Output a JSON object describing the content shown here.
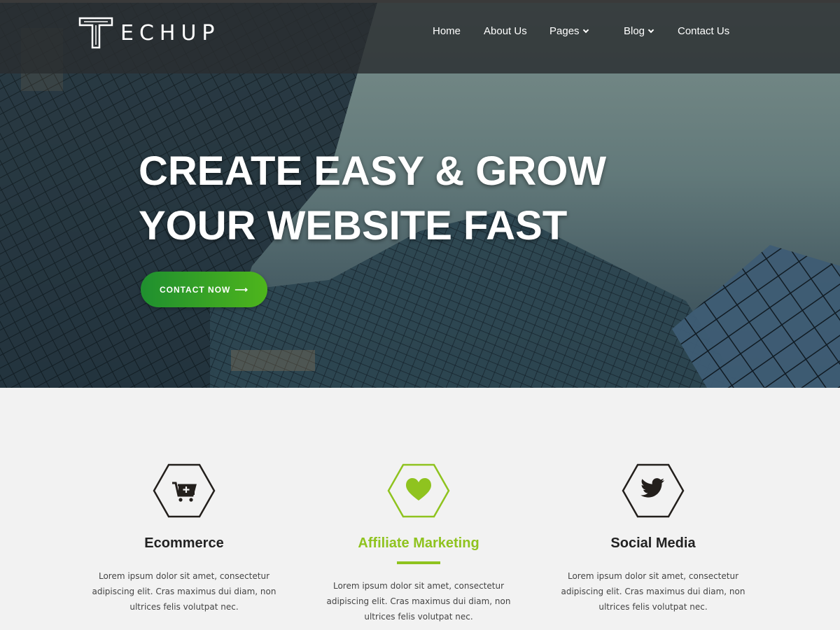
{
  "brand": {
    "name": "ECHUP"
  },
  "nav": {
    "items": [
      {
        "label": "Home",
        "has_dropdown": false
      },
      {
        "label": "About Us",
        "has_dropdown": false
      },
      {
        "label": "Pages",
        "has_dropdown": true
      },
      {
        "label": "Blog",
        "has_dropdown": true
      },
      {
        "label": "Contact Us",
        "has_dropdown": false
      }
    ]
  },
  "hero": {
    "headline_line1": "CREATE EASY & GROW",
    "headline_line2": "YOUR WEBSITE FAST",
    "cta_label": "CONTACT NOW",
    "cta_icon": "arrow-right-icon"
  },
  "features": [
    {
      "icon": "cart-plus-icon",
      "title": "Ecommerce",
      "active": false,
      "text": "Lorem ipsum dolor sit amet, consectetur adipiscing elit. Cras maximus dui diam, non ultrices felis volutpat nec."
    },
    {
      "icon": "heart-icon",
      "title": "Affiliate Marketing",
      "active": true,
      "text": "Lorem ipsum dolor sit amet, consectetur adipiscing elit. Cras maximus dui diam, non ultrices felis volutpat nec."
    },
    {
      "icon": "twitter-icon",
      "title": "Social Media",
      "active": false,
      "text": "Lorem ipsum dolor sit amet, consectetur adipiscing elit. Cras maximus dui diam, non ultrices felis volutpat nec."
    }
  ],
  "colors": {
    "accent": "#8fc31f",
    "cta_start": "#1f8f2f",
    "cta_end": "#4eb51c",
    "dark_icon": "#231f1c",
    "section_bg": "#f2f2f2"
  }
}
